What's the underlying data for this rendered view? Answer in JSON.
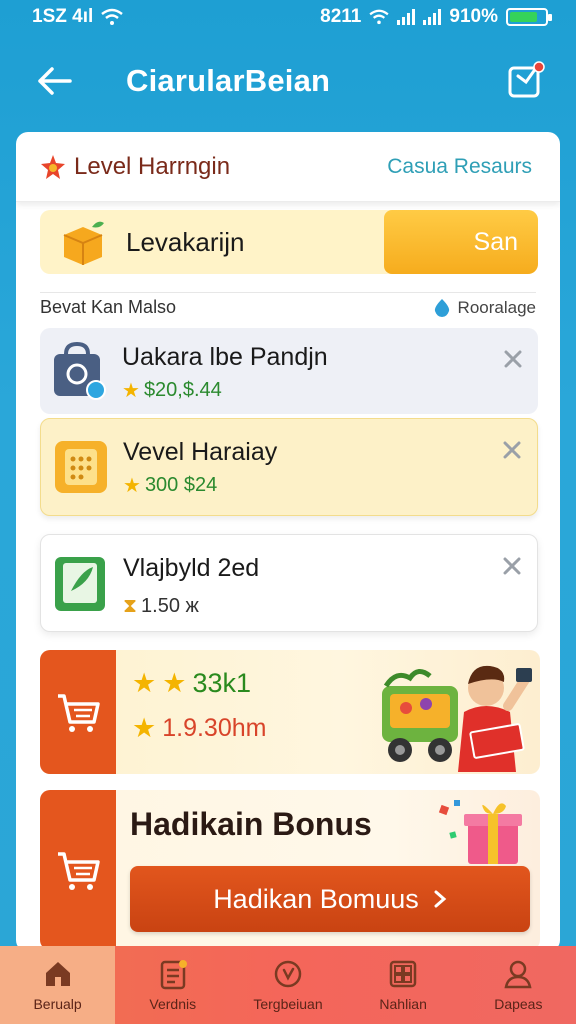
{
  "status_bar": {
    "time": "1SZ 4ıl",
    "network": "8211",
    "battery_percent": "910%",
    "battery_level": 0.8
  },
  "header": {
    "title": "CiarularBeian"
  },
  "card": {
    "level_title": "Level Harrngin",
    "category_link": "Casua Resaurs",
    "level_row": {
      "name": "Levakarijn",
      "button": "San"
    },
    "section": {
      "label": "Bevat Kan Malso",
      "link": "Rooralage"
    },
    "items": [
      {
        "name": "Uakara lbe Pandjn",
        "price": "$20,$.44"
      },
      {
        "name": "Vevel Haraiay",
        "price": "300 $24"
      },
      {
        "name": "Vlajbyld 2ed",
        "price": "1.50 ж"
      }
    ],
    "promo_banner": {
      "line1": "33k1",
      "line2": "1.9.30hm"
    },
    "bonus_banner": {
      "title": "Hadikain Bonus",
      "button": "Hadikan Bomuus"
    }
  },
  "bottom_nav": [
    {
      "label": "Berualp",
      "icon": "home-icon",
      "active": true
    },
    {
      "label": "Verdnis",
      "icon": "list-icon",
      "active": false
    },
    {
      "label": "Tergbeiuan",
      "icon": "clock-icon",
      "active": false
    },
    {
      "label": "Nahlian",
      "icon": "grid-icon",
      "active": false
    },
    {
      "label": "Dapeas",
      "icon": "user-icon",
      "active": false
    }
  ],
  "colors": {
    "primary_blue": "#1e9fd3",
    "accent_orange": "#e4561e",
    "gold": "#f6ac1d",
    "nav_bg": "#f06861"
  }
}
